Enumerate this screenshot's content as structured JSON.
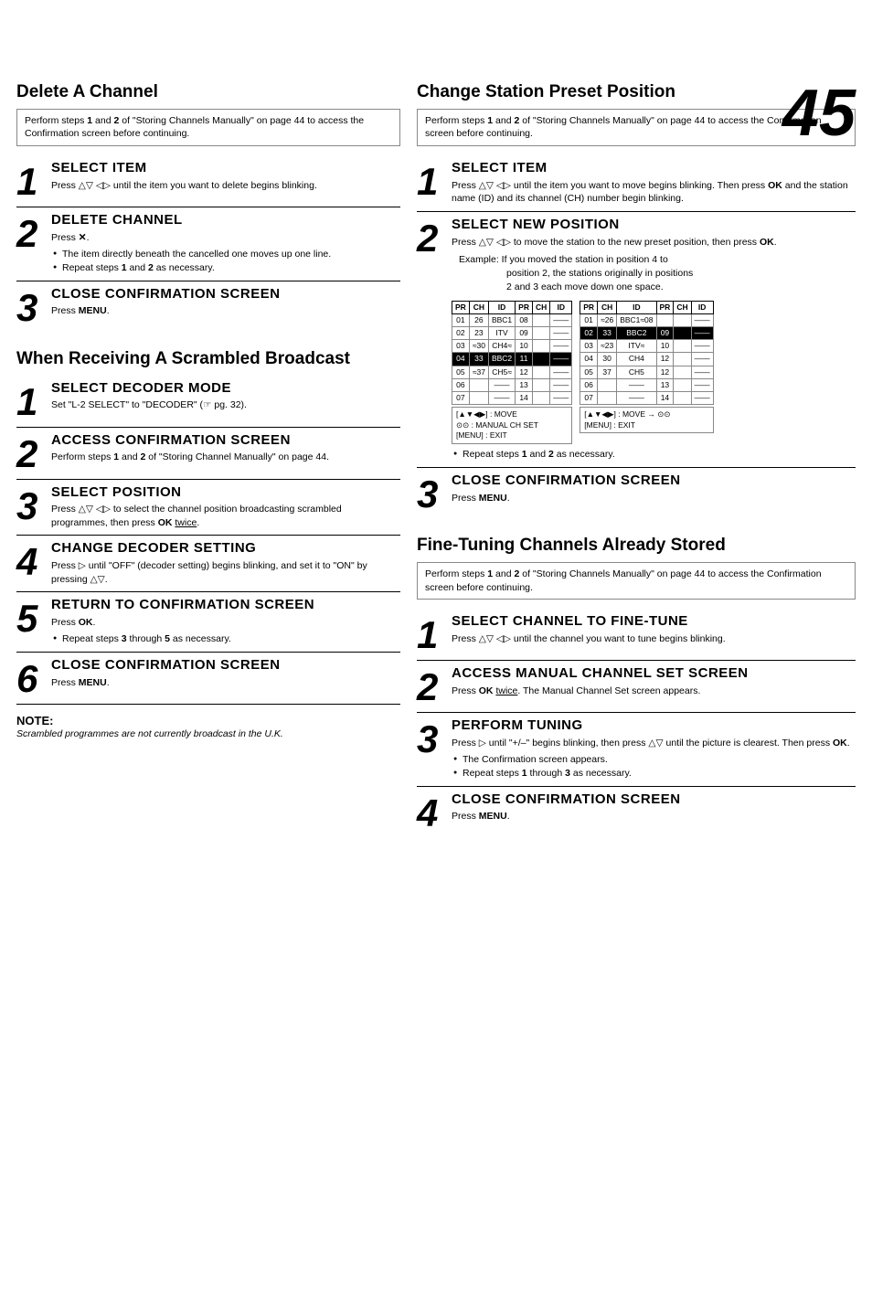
{
  "page_number": "45",
  "left_col": {
    "delete_channel": {
      "title": "Delete A Channel",
      "intro": {
        "text": "Perform steps 1 and 2 of \"Storing Channels Manually\" on page 44 to access the Confirmation screen before continuing.",
        "bold_parts": [
          "1",
          "2"
        ]
      },
      "steps": [
        {
          "number": "1",
          "heading": "SELECT ITEM",
          "text": "Press △▽ ◁▷ until the item you want to delete begins blinking."
        },
        {
          "number": "2",
          "heading": "DELETE CHANNEL",
          "text": "Press ✕.",
          "bullets": [
            "The item directly beneath the cancelled one moves up one line.",
            "Repeat steps 1 and 2 as necessary."
          ]
        },
        {
          "number": "3",
          "heading": "CLOSE CONFIRMATION SCREEN",
          "text": "Press MENU."
        }
      ]
    },
    "scrambled": {
      "title": "When Receiving A Scrambled Broadcast",
      "steps": [
        {
          "number": "1",
          "heading": "SELECT DECODER MODE",
          "text": "Set \"L-2 SELECT\" to \"DECODER\" (☞ pg. 32)."
        },
        {
          "number": "2",
          "heading": "ACCESS CONFIRMATION SCREEN",
          "text": "Perform steps 1 and 2 of \"Storing Channel Manually\" on page 44.",
          "bold_parts": [
            "1",
            "2"
          ]
        },
        {
          "number": "3",
          "heading": "SELECT POSITION",
          "text": "Press △▽ ◁▷ to select the channel position broadcasting scrambled programmes, then press OK twice.",
          "underline": "twice"
        },
        {
          "number": "4",
          "heading": "CHANGE DECODER SETTING",
          "text": "Press ▷ until \"OFF\" (decoder setting) begins blinking, and set it to \"ON\" by pressing △▽."
        },
        {
          "number": "5",
          "heading": "RETURN TO CONFIRMATION SCREEN",
          "text": "Press OK.",
          "bullets": [
            "Repeat steps 3 through 5 as necessary."
          ],
          "bold_parts": [
            "3",
            "5"
          ]
        },
        {
          "number": "6",
          "heading": "CLOSE CONFIRMATION SCREEN",
          "text": "Press MENU."
        }
      ],
      "note": {
        "title": "NOTE:",
        "text": "Scrambled programmes are not currently broadcast in the U.K."
      }
    }
  },
  "right_col": {
    "change_station": {
      "title": "Change Station Preset Position",
      "intro": {
        "text": "Perform steps 1 and 2 of \"Storing Channels Manually\" on page 44 to access the Confirmation screen before continuing."
      },
      "steps": [
        {
          "number": "1",
          "heading": "SELECT ITEM",
          "text": "Press △▽ ◁▷ until the item you want to move begins blinking. Then press OK and the station name (ID) and its channel (CH) number begin blinking.",
          "bold_parts": [
            "OK"
          ]
        },
        {
          "number": "2",
          "heading": "SELECT NEW POSITION",
          "text": "Press △▽ ◁▷ to move the station to the new preset position, then press OK.",
          "bold_parts": [
            "OK"
          ],
          "example": "Example: If you moved the station in position 4 to position 2, the stations originally in positions 2 and 3 each move down one space."
        },
        {
          "number": "3",
          "heading": "CLOSE CONFIRMATION SCREEN",
          "text": "Press MENU.",
          "bullets": [
            "Repeat steps 1 and 2 as necessary."
          ]
        }
      ],
      "table": {
        "before": {
          "headers": [
            "PR",
            "CH",
            "ID",
            "PR",
            "CH",
            "ID"
          ],
          "rows": [
            [
              "01",
              "26",
              "BBC1",
              "08",
              "",
              "----"
            ],
            [
              "02",
              "23",
              "ITV",
              "09",
              "",
              "----"
            ],
            [
              "03",
              "≈30",
              "CH4≈10",
              "",
              "",
              "----"
            ],
            [
              "04",
              "33",
              "BBC2",
              "11",
              "",
              "----"
            ],
            [
              "05",
              "≈37",
              "CH5≈12",
              "",
              "",
              "----"
            ],
            [
              "06",
              "",
              "----",
              "13",
              "",
              "----"
            ],
            [
              "07",
              "",
              "----",
              "14",
              "",
              "----"
            ]
          ],
          "caption": "[▲▼◀▶]: MOVE\n⊙⊙: MANUAL CH SET\n[MENU]: EXIT"
        },
        "after": {
          "headers": [
            "PR",
            "CH",
            "ID",
            "PR",
            "CH",
            "ID"
          ],
          "rows": [
            [
              "01",
              "≈26",
              "BBC1≈08",
              "",
              "",
              "----"
            ],
            [
              "02",
              "33",
              "BBC2",
              "09",
              "",
              "----"
            ],
            [
              "03",
              "≈23",
              "ITV≈10",
              "",
              "",
              "----"
            ],
            [
              "04",
              "30",
              "CH4",
              "12",
              "",
              "----"
            ],
            [
              "05",
              "37",
              "CH5",
              "12",
              "",
              "----"
            ],
            [
              "06",
              "",
              "----",
              "13",
              "",
              "----"
            ],
            [
              "07",
              "",
              "----",
              "14",
              "",
              "----"
            ]
          ],
          "highlight_row": 1,
          "caption": "[▲▼◀▶]: MOVE → ⊙⊙\n[MENU]: EXIT"
        }
      }
    },
    "fine_tuning": {
      "title": "Fine-Tuning Channels Already Stored",
      "intro": {
        "text": "Perform steps 1 and 2 of \"Storing Channels Manually\" on page 44 to access the Confirmation screen before continuing."
      },
      "steps": [
        {
          "number": "1",
          "heading": "SELECT CHANNEL TO FINE-TUNE",
          "text": "Press △▽ ◁▷ until the channel you want to tune begins blinking."
        },
        {
          "number": "2",
          "heading": "ACCESS MANUAL CHANNEL SET SCREEN",
          "text": "Press OK twice. The Manual Channel Set screen appears.",
          "bold_parts": [
            "OK",
            "twice"
          ]
        },
        {
          "number": "3",
          "heading": "PERFORM TUNING",
          "text": "Press ▷ until \"+/–\" begins blinking, then press △▽ until the picture is clearest. Then press OK.",
          "bold_parts": [
            "OK"
          ],
          "bullets": [
            "The Confirmation screen appears.",
            "Repeat steps 1 through 3 as necessary."
          ],
          "bold_bullet_parts": [
            "1",
            "3"
          ]
        },
        {
          "number": "4",
          "heading": "CLOSE CONFIRMATION SCREEN",
          "text": "Press MENU."
        }
      ]
    }
  }
}
